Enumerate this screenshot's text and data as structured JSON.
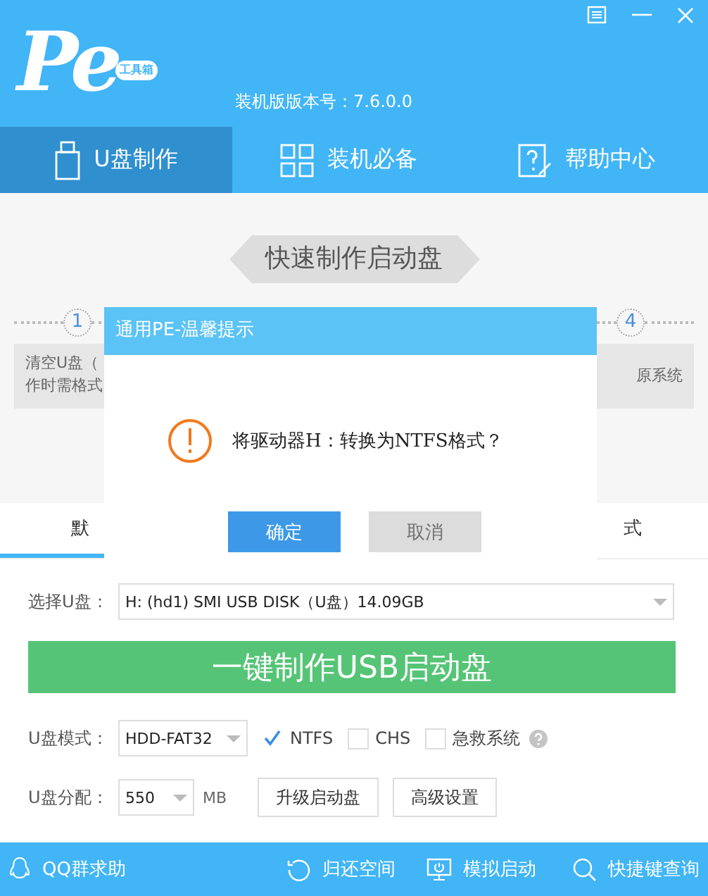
{
  "header": {
    "logo_text": "Pe",
    "logo_badge": "工具箱",
    "version": "装机版版本号：7.6.0.0"
  },
  "nav_tabs": [
    {
      "label": "U盘制作",
      "kind": "usb",
      "selected": true
    },
    {
      "label": "装机必备",
      "kind": "grid",
      "selected": false
    },
    {
      "label": "帮助中心",
      "kind": "help",
      "selected": false
    }
  ],
  "banner": "快速制作启动盘",
  "steps": [
    {
      "number": "1"
    },
    {
      "number": "4"
    }
  ],
  "step_cards": [
    {
      "lines": [
        "清空U盘（",
        "作时需格式"
      ]
    },
    {
      "lines": [
        "原系统"
      ]
    }
  ],
  "mode_tabs": [
    {
      "label": "默",
      "selected": true
    },
    {
      "label": "式",
      "selected": false
    }
  ],
  "dialog": {
    "title": "通用PE-温馨提示",
    "message": "将驱动器H：转换为NTFS格式？",
    "buttons": [
      {
        "label": "确定",
        "kind": "primary"
      },
      {
        "label": "取消",
        "kind": "secondary"
      }
    ]
  },
  "form": {
    "drive_label": "选择U盘：",
    "drive_value": "H: (hd1) SMI USB DISK（U盘）14.09GB",
    "make_button": "一键制作USB启动盘",
    "mode_label": "U盘模式：",
    "mode_value": "HDD-FAT32",
    "options": [
      {
        "label": "NTFS",
        "checked": true
      },
      {
        "label": "CHS",
        "checked": false
      },
      {
        "label": "急救系统",
        "checked": false
      }
    ],
    "alloc_label": "U盘分配：",
    "alloc_value": "550",
    "alloc_unit": "MB",
    "buttons": [
      "升级启动盘",
      "高级设置"
    ]
  },
  "footer": [
    {
      "label": "QQ群求助",
      "kind": "qq"
    },
    {
      "label": "归还空间",
      "kind": "restore"
    },
    {
      "label": "模拟启动",
      "kind": "monitor"
    },
    {
      "label": "快捷键查询",
      "kind": "search"
    }
  ]
}
